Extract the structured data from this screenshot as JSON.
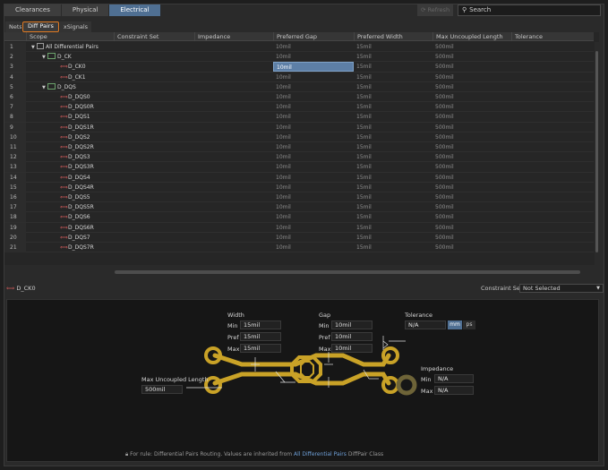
{
  "top_tabs": [
    {
      "label": "Clearances"
    },
    {
      "label": "Physical"
    },
    {
      "label": "Electrical",
      "active": true
    }
  ],
  "toolbar": {
    "refresh_label": "Refresh",
    "search_placeholder": "Search"
  },
  "sub_tabs": [
    {
      "label": "Nets"
    },
    {
      "label": "Diff Pairs",
      "active": true
    },
    {
      "label": "xSignals"
    }
  ],
  "columns": [
    "Scope",
    "Constraint Set",
    "Impedance",
    "Preferred Gap",
    "Preferred Width",
    "Max Uncoupled Length",
    "Tolerance"
  ],
  "rows": [
    {
      "num": "1",
      "scope": "All Differential Pairs",
      "kind": "root",
      "gap": "10mil",
      "width": "15mil",
      "uncoupled": "500mil"
    },
    {
      "num": "2",
      "scope": "D_CK",
      "kind": "class",
      "gap": "10mil",
      "width": "15mil",
      "uncoupled": "500mil"
    },
    {
      "num": "3",
      "scope": "D_CK0",
      "kind": "pair",
      "gap": "10mil",
      "width": "15mil",
      "uncoupled": "500mil",
      "selected": true
    },
    {
      "num": "4",
      "scope": "D_CK1",
      "kind": "pair",
      "gap": "10mil",
      "width": "15mil",
      "uncoupled": "500mil"
    },
    {
      "num": "5",
      "scope": "D_DQS",
      "kind": "class",
      "gap": "10mil",
      "width": "15mil",
      "uncoupled": "500mil"
    },
    {
      "num": "6",
      "scope": "D_DQS0",
      "kind": "pair",
      "gap": "10mil",
      "width": "15mil",
      "uncoupled": "500mil"
    },
    {
      "num": "7",
      "scope": "D_DQS0R",
      "kind": "pair",
      "gap": "10mil",
      "width": "15mil",
      "uncoupled": "500mil"
    },
    {
      "num": "8",
      "scope": "D_DQS1",
      "kind": "pair",
      "gap": "10mil",
      "width": "15mil",
      "uncoupled": "500mil"
    },
    {
      "num": "9",
      "scope": "D_DQS1R",
      "kind": "pair",
      "gap": "10mil",
      "width": "15mil",
      "uncoupled": "500mil"
    },
    {
      "num": "10",
      "scope": "D_DQS2",
      "kind": "pair",
      "gap": "10mil",
      "width": "15mil",
      "uncoupled": "500mil"
    },
    {
      "num": "11",
      "scope": "D_DQS2R",
      "kind": "pair",
      "gap": "10mil",
      "width": "15mil",
      "uncoupled": "500mil"
    },
    {
      "num": "12",
      "scope": "D_DQS3",
      "kind": "pair",
      "gap": "10mil",
      "width": "15mil",
      "uncoupled": "500mil"
    },
    {
      "num": "13",
      "scope": "D_DQS3R",
      "kind": "pair",
      "gap": "10mil",
      "width": "15mil",
      "uncoupled": "500mil"
    },
    {
      "num": "14",
      "scope": "D_DQS4",
      "kind": "pair",
      "gap": "10mil",
      "width": "15mil",
      "uncoupled": "500mil"
    },
    {
      "num": "15",
      "scope": "D_DQS4R",
      "kind": "pair",
      "gap": "10mil",
      "width": "15mil",
      "uncoupled": "500mil"
    },
    {
      "num": "16",
      "scope": "D_DQS5",
      "kind": "pair",
      "gap": "10mil",
      "width": "15mil",
      "uncoupled": "500mil"
    },
    {
      "num": "17",
      "scope": "D_DQS5R",
      "kind": "pair",
      "gap": "10mil",
      "width": "15mil",
      "uncoupled": "500mil"
    },
    {
      "num": "18",
      "scope": "D_DQS6",
      "kind": "pair",
      "gap": "10mil",
      "width": "15mil",
      "uncoupled": "500mil"
    },
    {
      "num": "19",
      "scope": "D_DQS6R",
      "kind": "pair",
      "gap": "10mil",
      "width": "15mil",
      "uncoupled": "500mil"
    },
    {
      "num": "20",
      "scope": "D_DQS7",
      "kind": "pair",
      "gap": "10mil",
      "width": "15mil",
      "uncoupled": "500mil"
    },
    {
      "num": "21",
      "scope": "D_DQS7R",
      "kind": "pair",
      "gap": "10mil",
      "width": "15mil",
      "uncoupled": "500mil"
    }
  ],
  "selected_object": {
    "name": "D_CK0",
    "constraint_set_label": "Constraint Set",
    "constraint_set_value": "Not Selected"
  },
  "diagram": {
    "width": {
      "title": "Width",
      "min_label": "Min",
      "min": "15mil",
      "pref_label": "Pref",
      "pref": "15mil",
      "max_label": "Max",
      "max": "15mil"
    },
    "gap": {
      "title": "Gap",
      "min_label": "Min",
      "min": "10mil",
      "pref_label": "Pref",
      "pref": "10mil",
      "max_label": "Max",
      "max": "10mil"
    },
    "tolerance": {
      "title": "Tolerance",
      "value": "N/A",
      "unit_mm": "mm",
      "unit_ps": "ps"
    },
    "uncoupled": {
      "title": "Max Uncoupled Length",
      "value": "500mil"
    },
    "impedance": {
      "title": "Impedance",
      "min_label": "Min",
      "min": "N/A",
      "max_label": "Max",
      "max": "N/A"
    },
    "footer_prefix": "For rule: Differential Pairs Routing. Values are inherited from",
    "footer_link": "All Differential Pairs",
    "footer_suffix": "DiffPair Class"
  },
  "colors": {
    "accent": "#4f6f92",
    "selection": "#5d7fa6",
    "highlight": "#e07a22",
    "trace": "#c9a227"
  }
}
